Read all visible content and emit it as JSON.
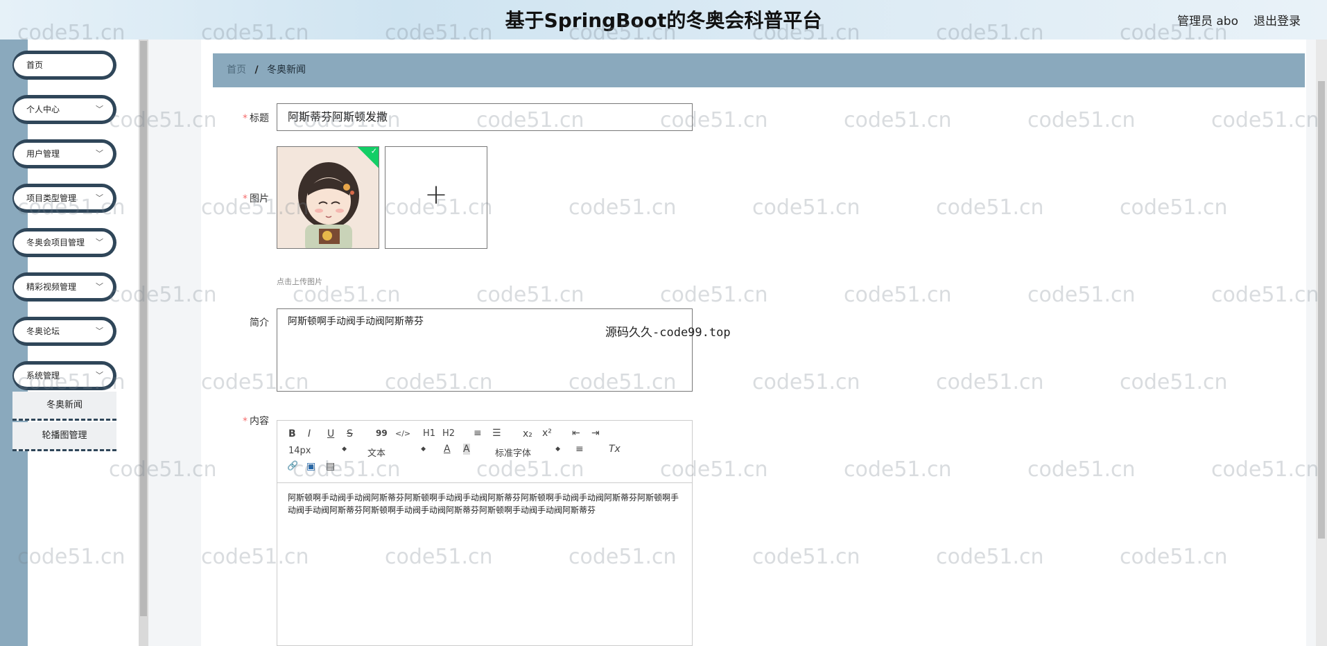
{
  "header": {
    "title": "基于SpringBoot的冬奥会科普平台",
    "user": "管理员 abo",
    "logout": "退出登录"
  },
  "sidebar": {
    "items": [
      {
        "label": "首页"
      },
      {
        "label": "个人中心"
      },
      {
        "label": "用户管理"
      },
      {
        "label": "项目类型管理"
      },
      {
        "label": "冬奥会项目管理"
      },
      {
        "label": "精彩视频管理"
      },
      {
        "label": "冬奥论坛"
      },
      {
        "label": "系统管理"
      }
    ],
    "sub_items": [
      {
        "label": "冬奥新闻"
      },
      {
        "label": "轮播图管理"
      }
    ],
    "chevron": "﹀"
  },
  "breadcrumb": {
    "home": "首页",
    "separator": "/",
    "current": "冬奥新闻"
  },
  "form": {
    "title_label": "标题",
    "title_value": "阿斯蒂芬阿斯顿发撒",
    "image_label": "图片",
    "upload_tip": "点击上传图片",
    "upload_plus": "+",
    "intro_label": "简介",
    "intro_value": "阿斯顿啊手动阀手动阀阿斯蒂芬",
    "content_label": "内容",
    "required_mark": "*"
  },
  "editor": {
    "font_size": "14px",
    "header_select": "文本",
    "font_family": "标准字体",
    "body": "阿斯顿啊手动阀手动阀阿斯蒂芬阿斯顿啊手动阀手动阀阿斯蒂芬阿斯顿啊手动阀手动阀阿斯蒂芬阿斯顿啊手动阀手动阀阿斯蒂芬阿斯顿啊手动阀手动阀阿斯蒂芬阿斯顿啊手动阀手动阀阿斯蒂芬",
    "tools": {
      "bold": "B",
      "italic": "I",
      "underline": "U",
      "strike": "S",
      "quote": "99",
      "code": "</>",
      "h1": "H1",
      "h2": "H2",
      "ordered_list": "≡",
      "bullet_list": "☰",
      "subscript": "x₂",
      "superscript": "x²",
      "outdent": "⇤",
      "indent": "⇥",
      "color": "A",
      "background": "A",
      "align": "≡",
      "clean": "Tx",
      "link": "🔗",
      "image": "▣",
      "video": "▤"
    }
  },
  "overlay_text": "源码久久-code99.top",
  "watermark": "code51.cn"
}
